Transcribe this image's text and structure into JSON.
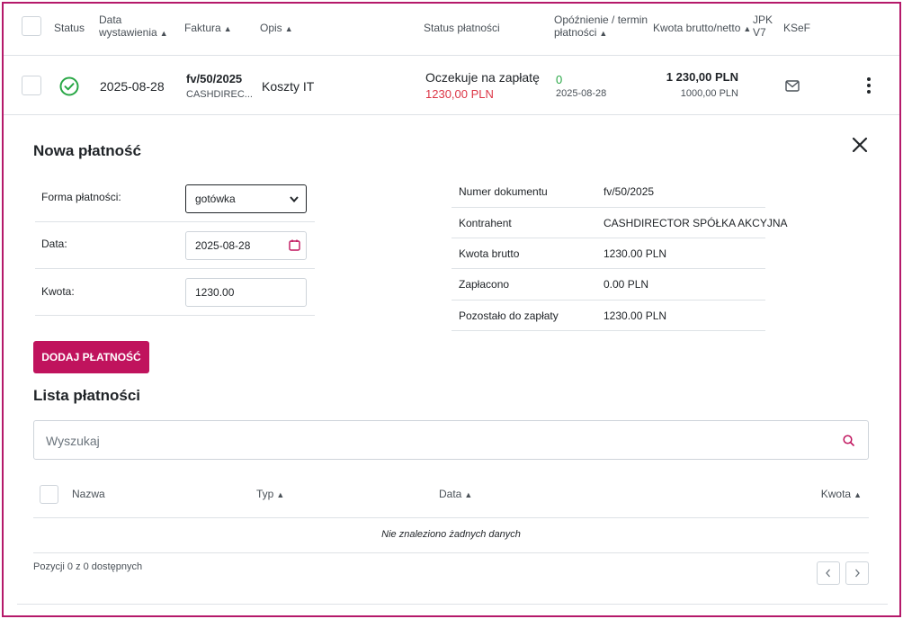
{
  "table": {
    "headers": {
      "status": "Status",
      "issue_date_1": "Data",
      "issue_date_2": "wystawienia",
      "invoice": "Faktura",
      "description": "Opis",
      "payment_status": "Status płatności",
      "delay_1": "Opóźnienie / termin",
      "delay_2": "płatności",
      "amount": "Kwota brutto/netto",
      "jpk_1": "JPK",
      "jpk_2": "V7",
      "ksef": "KSeF"
    },
    "row": {
      "date": "2025-08-28",
      "invoice_number": "fv/50/2025",
      "contractor_short": "CASHDIREC...",
      "description": "Koszty IT",
      "payment_status": "Oczekuje na zapłatę",
      "payment_amount": "1230,00 PLN",
      "delay_days": "0",
      "due_date": "2025-08-28",
      "gross": "1 230,00 PLN",
      "net": "1000,00 PLN"
    }
  },
  "new_payment": {
    "title": "Nowa płatność",
    "form": {
      "method_label": "Forma płatności:",
      "method_value": "gotówka",
      "date_label": "Data:",
      "date_value": "2025-08-28",
      "amount_label": "Kwota:",
      "amount_value": "1230.00"
    },
    "info": [
      {
        "label": "Numer dokumentu",
        "value": "fv/50/2025"
      },
      {
        "label": "Kontrahent",
        "value": "CASHDIRECTOR SPÓŁKA AKCYJNA"
      },
      {
        "label": "Kwota brutto",
        "value": "1230.00 PLN"
      },
      {
        "label": "Zapłacono",
        "value": "0.00 PLN"
      },
      {
        "label": "Pozostało do zapłaty",
        "value": "1230.00 PLN"
      }
    ],
    "add_button": "DODAJ PŁATNOŚĆ"
  },
  "payments_list": {
    "title": "Lista płatności",
    "search_placeholder": "Wyszukaj",
    "columns": {
      "name": "Nazwa",
      "type": "Typ",
      "date": "Data",
      "amount": "Kwota"
    },
    "empty": "Nie znaleziono żadnych danych",
    "footer": "Pozycji 0 z 0 dostępnych"
  },
  "colors": {
    "accent": "#c0135d",
    "success": "#28a745",
    "danger": "#dc3545",
    "border": "#b5196a"
  },
  "icons": [
    "check-circle-icon",
    "mail-icon",
    "kebab-menu-icon",
    "close-icon",
    "calendar-icon",
    "search-icon",
    "chevron-left-icon",
    "chevron-right-icon",
    "sort-icon"
  ]
}
